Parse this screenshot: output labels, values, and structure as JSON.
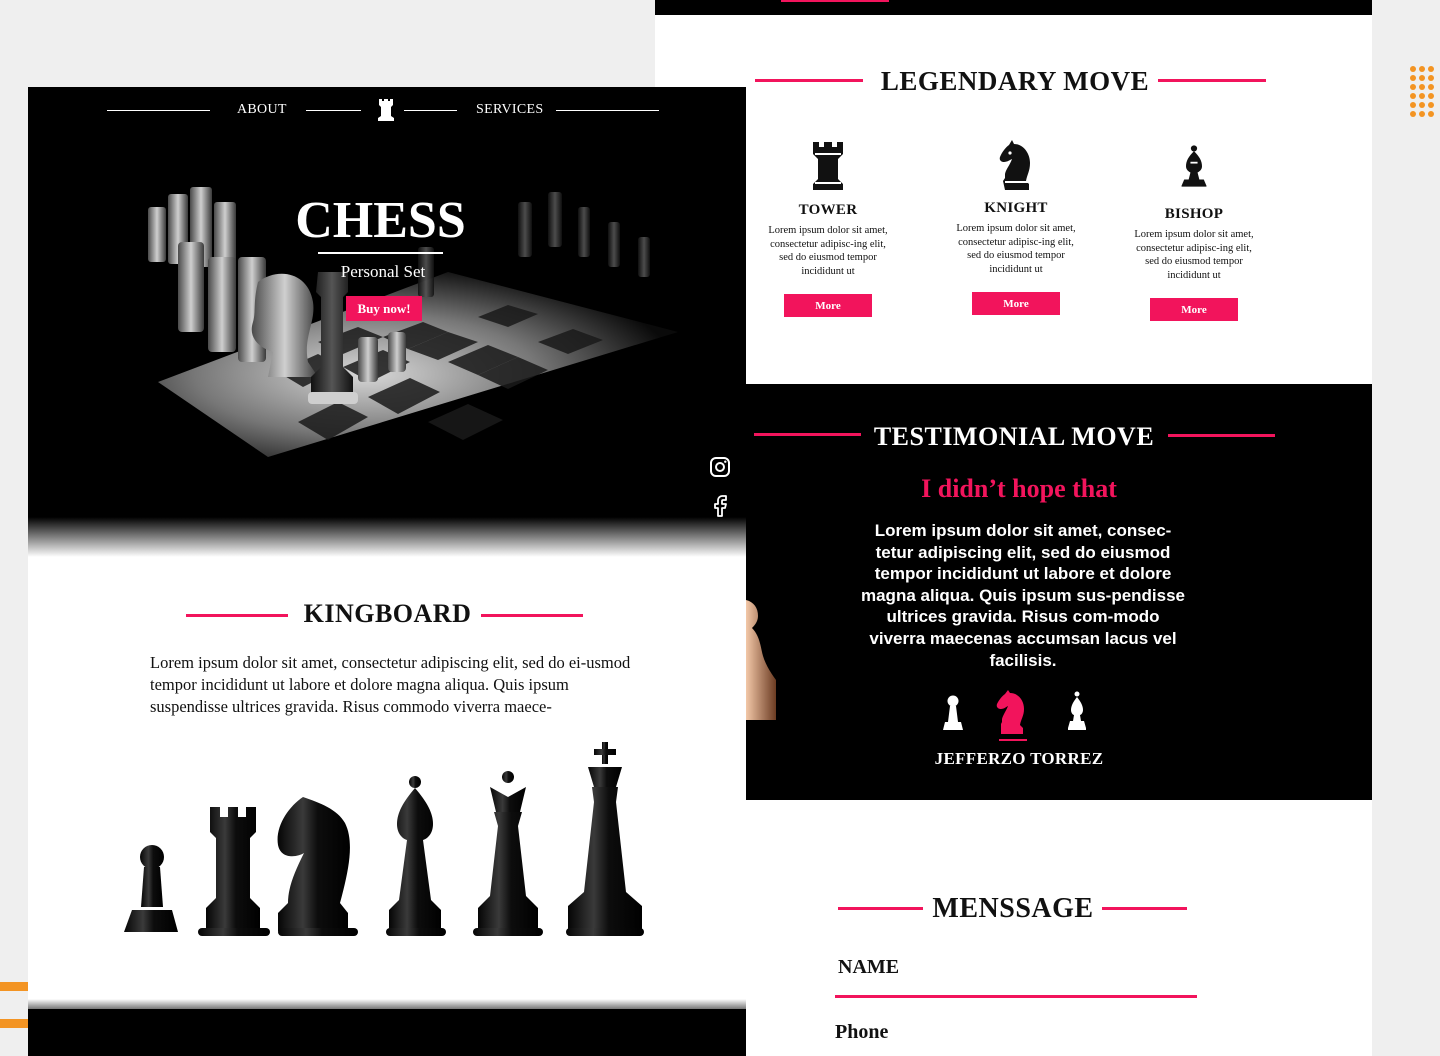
{
  "nav": {
    "about": "ABOUT",
    "services": "SERVICES",
    "logo_icon": "rook-icon"
  },
  "hero": {
    "title": "CHESS",
    "subtitle": "Personal Set",
    "buy_label": "Buy now!"
  },
  "social": {
    "instagram_icon": "instagram-icon",
    "facebook_icon": "facebook-icon"
  },
  "kingboard": {
    "title": "KINGBOARD",
    "text": "Lorem ipsum dolor sit amet, consectetur adipiscing elit, sed do ei-usmod tempor incididunt ut labore et dolore magna aliqua. Quis ipsum suspendisse ultrices gravida. Risus commodo viverra maece-"
  },
  "legendary": {
    "title": "LEGENDARY MOVE",
    "cards": [
      {
        "name": "TOWER",
        "icon": "rook-icon",
        "text": "Lorem ipsum dolor sit amet, consectetur adipisc-ing elit, sed do eiusmod tempor incididunt ut",
        "button": "More"
      },
      {
        "name": "KNIGHT",
        "icon": "knight-icon",
        "text": "Lorem ipsum dolor sit amet, consectetur adipisc-ing elit, sed do eiusmod tempor incididunt ut",
        "button": "More"
      },
      {
        "name": "BISHOP",
        "icon": "bishop-icon",
        "text": "Lorem ipsum dolor sit amet, consectetur adipisc-ing elit, sed do eiusmod tempor incididunt ut",
        "button": "More"
      }
    ]
  },
  "testimonial": {
    "title": "TESTIMONIAL MOVE",
    "quote": "I didn’t hope that",
    "text": "Lorem ipsum dolor sit amet, consec-tetur adipiscing elit, sed do eiusmod tempor incididunt ut labore et dolore magna aliqua. Quis ipsum sus-pendisse ultrices gravida. Risus com-modo viverra maecenas accumsan lacus vel facilisis.",
    "author": "JEFFERZO TORREZ"
  },
  "message": {
    "title": "MENSSAGE",
    "name_label": "NAME",
    "phone_label": "Phone"
  },
  "colors": {
    "accent": "#f2145c",
    "decor": "#f39423",
    "dark": "#000000"
  }
}
